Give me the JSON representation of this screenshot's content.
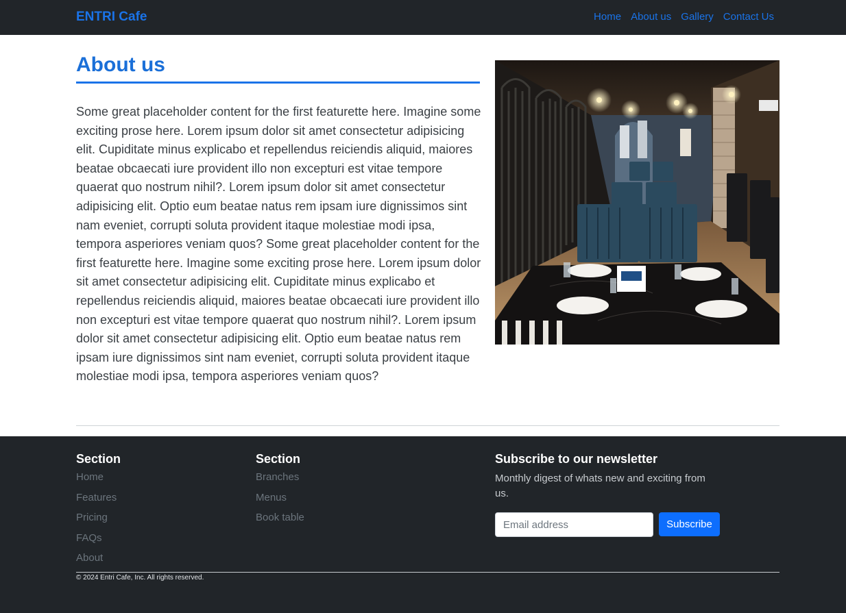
{
  "nav": {
    "brand": "ENTRI Cafe",
    "links": [
      "Home",
      "About us",
      "Gallery",
      "Contact Us"
    ]
  },
  "about": {
    "title": "About us",
    "body": "Some great placeholder content for the first featurette here. Imagine some exciting prose here. Lorem ipsum dolor sit amet consectetur adipisicing elit. Cupiditate minus explicabo et repellendus reiciendis aliquid, maiores beatae obcaecati iure provident illo non excepturi est vitae tempore quaerat quo nostrum nihil?. Lorem ipsum dolor sit amet consectetur adipisicing elit. Optio eum beatae natus rem ipsam iure dignissimos sint nam eveniet, corrupti soluta provident itaque molestiae modi ipsa, tempora asperiores veniam quos? Some great placeholder content for the first featurette here. Imagine some exciting prose here. Lorem ipsum dolor sit amet consectetur adipisicing elit. Cupiditate minus explicabo et repellendus reiciendis aliquid, maiores beatae obcaecati iure provident illo non excepturi est vitae tempore quaerat quo nostrum nihil?. Lorem ipsum dolor sit amet consectetur adipisicing elit. Optio eum beatae natus rem ipsam iure dignissimos sint nam eveniet, corrupti soluta provident itaque molestiae modi ipsa, tempora asperiores veniam quos?"
  },
  "footer": {
    "section1": {
      "title": "Section",
      "links": [
        "Home",
        "Features",
        "Pricing",
        "FAQs",
        "About"
      ]
    },
    "section2": {
      "title": "Section",
      "links": [
        "Branches",
        "Menus",
        "Book table"
      ]
    },
    "newsletter": {
      "title": "Subscribe to our newsletter",
      "description": "Monthly digest of whats new and exciting from us.",
      "email_placeholder": "Email address",
      "button_label": "Subscribe"
    },
    "copyright": "© 2024 Entri Cafe, Inc. All rights reserved."
  },
  "colors": {
    "accent": "#1a73e8",
    "dark": "#212529",
    "button": "#0d6efd"
  }
}
